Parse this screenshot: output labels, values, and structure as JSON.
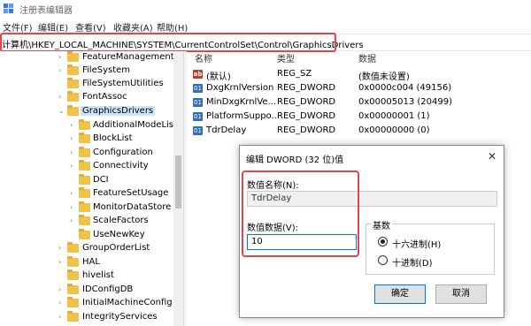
{
  "window": {
    "title": "注册表编辑器"
  },
  "menu": [
    "文件(F)",
    "编辑(E)",
    "查看(V)",
    "收藏夹(A)",
    "帮助(H)"
  ],
  "address": "计算机\\HKEY_LOCAL_MACHINE\\SYSTEM\\CurrentControlSet\\Control\\GraphicsDrivers",
  "tree": [
    {
      "label": "FeatureManagement",
      "selected": false
    },
    {
      "label": "FileSystem",
      "selected": false
    },
    {
      "label": "FileSystemUtilities",
      "selected": false
    },
    {
      "label": "FontAssoc",
      "selected": false
    },
    {
      "label": "GraphicsDrivers",
      "selected": true
    },
    {
      "label": "AdditionalModeLists",
      "selected": false
    },
    {
      "label": "BlockList",
      "selected": false
    },
    {
      "label": "Configuration",
      "selected": false
    },
    {
      "label": "Connectivity",
      "selected": false
    },
    {
      "label": "DCI",
      "selected": false
    },
    {
      "label": "FeatureSetUsage",
      "selected": false
    },
    {
      "label": "MonitorDataStore",
      "selected": false
    },
    {
      "label": "ScaleFactors",
      "selected": false
    },
    {
      "label": "UseNewKey",
      "selected": false
    },
    {
      "label": "GroupOrderList",
      "selected": false
    },
    {
      "label": "HAL",
      "selected": false
    },
    {
      "label": "hivelist",
      "selected": false
    },
    {
      "label": "IDConfigDB",
      "selected": false
    },
    {
      "label": "InitialMachineConfig",
      "selected": false
    },
    {
      "label": "IntegrityServices",
      "selected": false
    }
  ],
  "list": {
    "headers": {
      "name": "名称",
      "type": "类型",
      "data": "数据"
    },
    "rows": [
      {
        "icon": "string-value-icon",
        "glyph": "ab",
        "name": "(默认)",
        "type": "REG_SZ",
        "data": "(数值未设置)"
      },
      {
        "icon": "dword-value-icon",
        "glyph": "01",
        "name": "DxgKrnlVersion",
        "type": "REG_DWORD",
        "data": "0x0000c004 (49156)"
      },
      {
        "icon": "dword-value-icon",
        "glyph": "01",
        "name": "MinDxgKrnlVe...",
        "type": "REG_DWORD",
        "data": "0x00005013 (20499)"
      },
      {
        "icon": "dword-value-icon",
        "glyph": "01",
        "name": "PlatformSuppo...",
        "type": "REG_DWORD",
        "data": "0x00000001 (1)"
      },
      {
        "icon": "dword-value-icon",
        "glyph": "01",
        "name": "TdrDelay",
        "type": "REG_DWORD",
        "data": "0x00000000 (0)"
      }
    ]
  },
  "dialog": {
    "title": "编辑 DWORD (32 位)值",
    "close": "✕",
    "name_label": "数值名称(N):",
    "name_value": "TdrDelay",
    "data_label": "数值数据(V):",
    "data_value": "10",
    "base_label": "基数",
    "hex_label": "十六进制(H)",
    "dec_label": "十进制(D)",
    "ok": "确定",
    "cancel": "取消"
  }
}
